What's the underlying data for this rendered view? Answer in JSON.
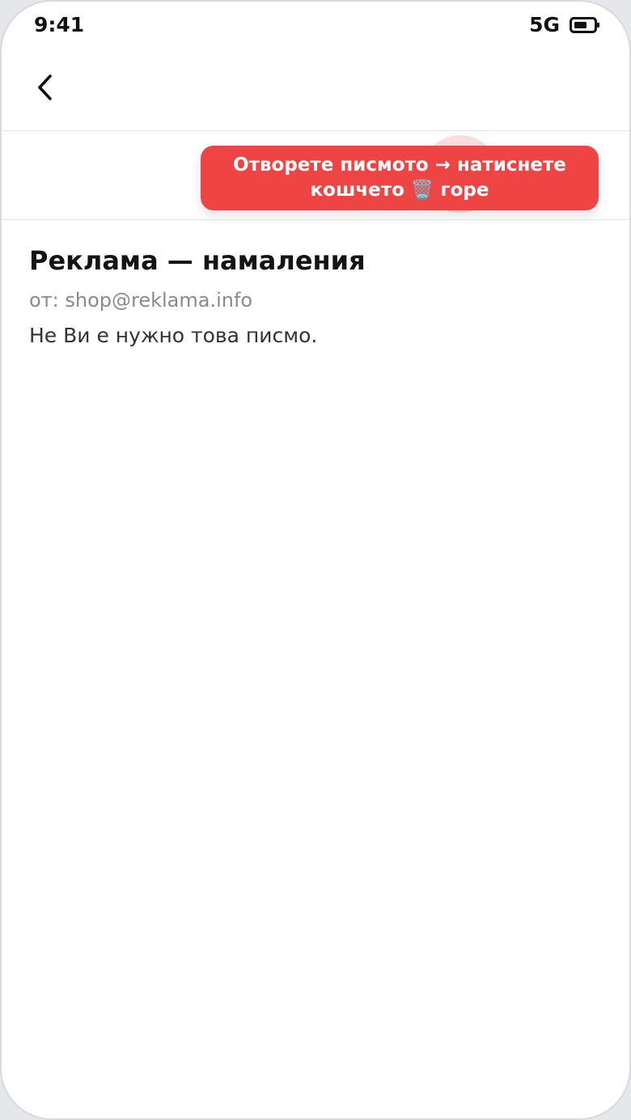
{
  "status_bar": {
    "time": "9:41",
    "network": "5G",
    "battery_icon": "battery-icon"
  },
  "nav": {
    "back_icon": "chevron-left-icon"
  },
  "toolbar": {
    "hint_line1": "Отворете писмото → натиснете",
    "hint_line2": "кошчето 🗑️ горе",
    "accent_color": "#ef4444"
  },
  "mail": {
    "subject": "Реклама — намаления",
    "from": "от: shop@reklama.info",
    "body": "Не Ви е нужно това писмо."
  }
}
